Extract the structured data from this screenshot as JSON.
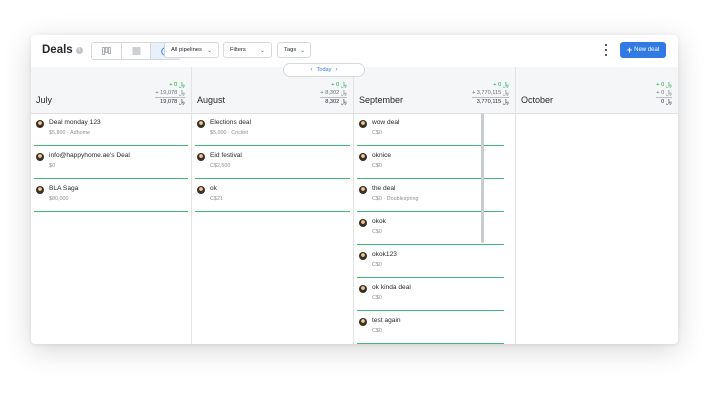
{
  "header": {
    "title": "Deals",
    "info_icon": "i",
    "view_icons": [
      "kanban-icon",
      "list-icon",
      "forecast-icon"
    ],
    "pipeline_dropdown": "All pipelines",
    "filters_dropdown": "Filters",
    "tags_dropdown": "Tags",
    "more_icon": "kebab-icon",
    "new_deal_label": "New deal",
    "new_deal_plus": "+"
  },
  "today_nav": {
    "label": "Today",
    "prev": "‹",
    "next": "›"
  },
  "colors": {
    "accent": "#317ae2",
    "won_line": "#3fb879",
    "positive": "#08a742"
  },
  "columns": [
    {
      "name": "July",
      "sum_new": "+ 0 ﷼",
      "sum_weighted": "+ 19,078 ﷼",
      "total": "19,078 ﷼",
      "cards": [
        {
          "name": "Deal monday 123",
          "meta": "$5,800 · Adhome"
        },
        {
          "name": "info@happyhome.ae's Deal",
          "meta": "$0"
        },
        {
          "name": "BLA Saga",
          "meta": "$80,000"
        }
      ]
    },
    {
      "name": "August",
      "sum_new": "+ 0 ﷼",
      "sum_weighted": "+ 8,302 ﷼",
      "total": "8,302 ﷼",
      "cards": [
        {
          "name": "Elections deal",
          "meta": "$5,000 · Cricket"
        },
        {
          "name": "Eid festival",
          "meta": "C$2,500"
        },
        {
          "name": "ok",
          "meta": "C$21"
        }
      ]
    },
    {
      "name": "September",
      "sum_new": "+ 0 ﷼",
      "sum_weighted": "+ 3,770,115 ﷼",
      "total": "3,770,115 ﷼",
      "cards": [
        {
          "name": "wow deal",
          "meta": "C$0"
        },
        {
          "name": "oknice",
          "meta": "C$0"
        },
        {
          "name": "the deal",
          "meta": "C$0 · Doublespring"
        },
        {
          "name": "okok",
          "meta": "C$0"
        },
        {
          "name": "okok123",
          "meta": "C$0"
        },
        {
          "name": "ok kinda deal",
          "meta": "C$0"
        },
        {
          "name": "test again",
          "meta": "C$0"
        }
      ]
    },
    {
      "name": "October",
      "sum_new": "+ 0 ﷼",
      "sum_weighted": "+ 0 ﷼",
      "total": "0 ﷼",
      "cards": []
    }
  ]
}
